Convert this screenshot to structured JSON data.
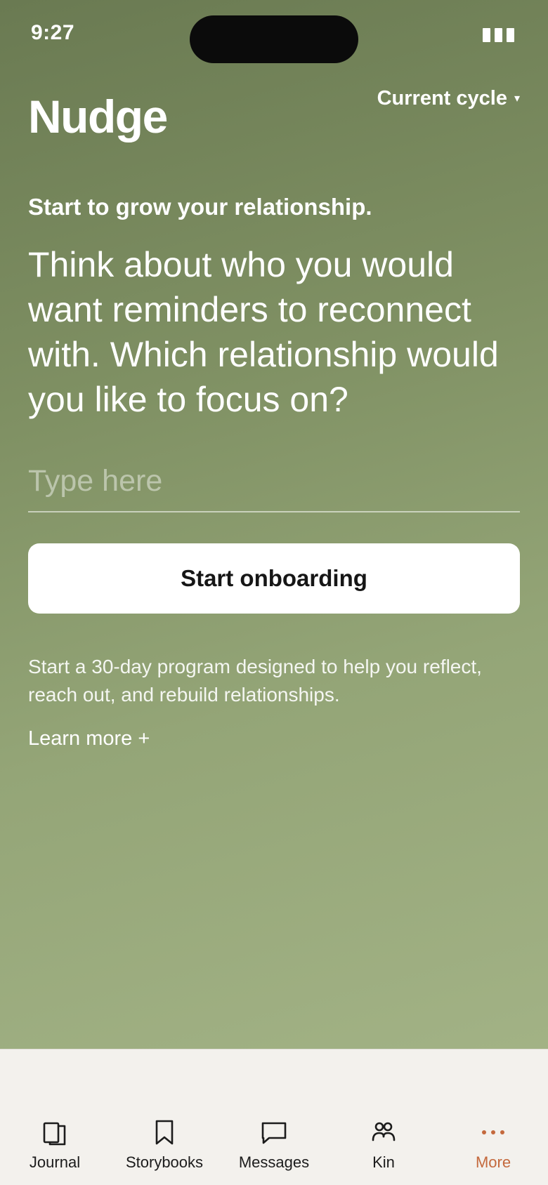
{
  "status_bar": {
    "time": "9:27"
  },
  "header": {
    "brand": "Nudge",
    "cycle_label": "Current cycle",
    "cycle_caret": "▾"
  },
  "main": {
    "subhead": "Start to grow your relationship.",
    "question": "Think about who you would want reminders to reconnect with. Which relationship would you like to focus on?",
    "input_placeholder": "Type here",
    "input_value": "",
    "cta_label": "Start onboarding",
    "description": "Start a 30-day program designed to help you reflect, reach out, and rebuild relationships.",
    "learn_more": "Learn more +"
  },
  "tabbar": {
    "items": [
      {
        "label": "Journal",
        "icon": "journal-icon"
      },
      {
        "label": "Storybooks",
        "icon": "bookmark-icon"
      },
      {
        "label": "Messages",
        "icon": "message-icon"
      },
      {
        "label": "Kin",
        "icon": "people-icon"
      },
      {
        "label": "More",
        "icon": "more-icon",
        "active": true
      }
    ]
  },
  "colors": {
    "gradient_top": "#6a7a52",
    "gradient_bottom": "#a2b285",
    "tabbar_bg": "#f3f1ed",
    "accent": "#c4693d"
  }
}
